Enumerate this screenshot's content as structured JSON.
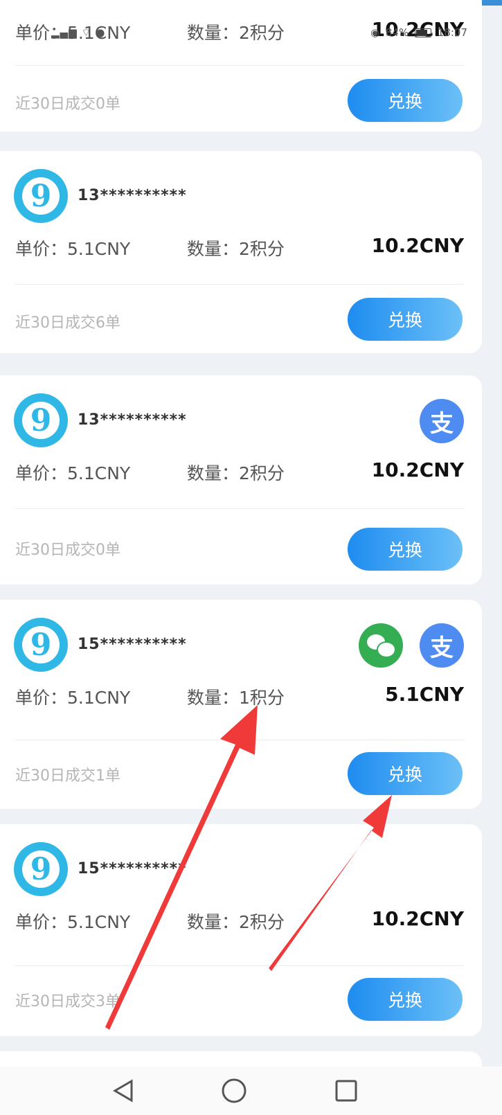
{
  "status_bar": {
    "time": "18:07",
    "battery": "84%"
  },
  "cards": [
    {
      "price_label": "单价：5.1CNY",
      "qty_label": "数量：2积分",
      "total": "10.2CNY",
      "deals": "近30日成交0单",
      "button": "兑换"
    },
    {
      "phone": "13**********",
      "price_label": "单价：5.1CNY",
      "qty_label": "数量：2积分",
      "total": "10.2CNY",
      "deals": "近30日成交6单",
      "button": "兑换"
    },
    {
      "phone": "13**********",
      "price_label": "单价：5.1CNY",
      "qty_label": "数量：2积分",
      "total": "10.2CNY",
      "deals": "近30日成交0单",
      "button": "兑换",
      "pay_methods": [
        "alipay"
      ],
      "alipay_glyph": "支"
    },
    {
      "phone": "15**********",
      "price_label": "单价：5.1CNY",
      "qty_label": "数量：1积分",
      "total": "5.1CNY",
      "deals": "近30日成交1单",
      "button": "兑换",
      "pay_methods": [
        "wechat",
        "alipay"
      ],
      "alipay_glyph": "支"
    },
    {
      "phone": "15**********",
      "price_label": "单价：5.1CNY",
      "qty_label": "数量：2积分",
      "total": "10.2CNY",
      "deals": "近30日成交3单",
      "button": "兑换"
    }
  ],
  "avatar_glyph": "9",
  "icons": {
    "nav_back": "back-triangle-icon",
    "nav_home": "home-circle-icon",
    "nav_recent": "recent-square-icon",
    "alipay": "alipay-icon",
    "wechat": "wechat-icon",
    "annotation": "red-arrow"
  },
  "colors": {
    "accent_blue": "#1e8cf0",
    "alipay_blue": "#4f8cf1",
    "wechat_green": "#35ad53",
    "arrow_red": "#f03a3a",
    "avatar_cyan": "#2fb7e6"
  }
}
